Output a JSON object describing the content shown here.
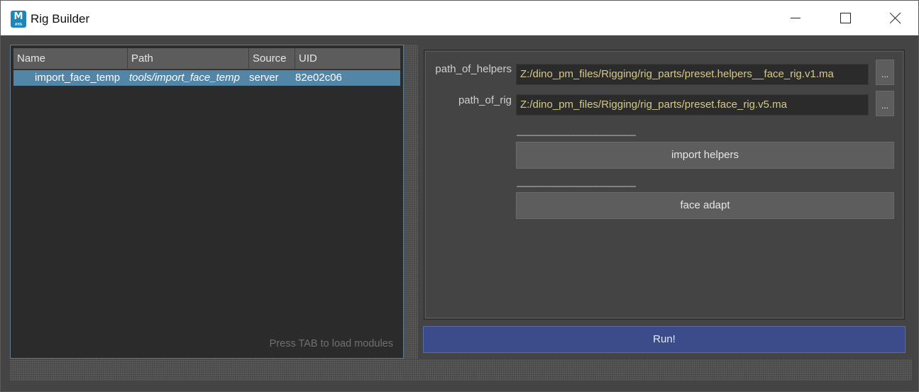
{
  "window": {
    "title": "Rig Builder",
    "app_icon_letter": "M",
    "app_icon_sub": "AYA"
  },
  "tree": {
    "columns": [
      "Name",
      "Path",
      "Source",
      "UID"
    ],
    "rows": [
      {
        "name": "import_face_temp",
        "path": "tools/import_face_temp",
        "source": "server",
        "uid": "82e02c06"
      }
    ],
    "hint": "Press TAB to load modules"
  },
  "attributes": {
    "path_of_helpers": {
      "label": "path_of_helpers",
      "value": "Z:/dino_pm_files/Rigging/rig_parts/preset.helpers__face_rig.v1.ma",
      "browse_label": "..."
    },
    "path_of_rig": {
      "label": "path_of_rig",
      "value": "Z:/dino_pm_files/Rigging/rig_parts/preset.face_rig.v5.ma",
      "browse_label": "..."
    },
    "separator_text": "____________________________",
    "import_helpers_label": "import helpers",
    "face_adapt_label": "face adapt"
  },
  "run_label": "Run!",
  "colors": {
    "selection": "#5285a6",
    "run_button": "#3c4c8a",
    "field_text": "#d4c98a"
  }
}
